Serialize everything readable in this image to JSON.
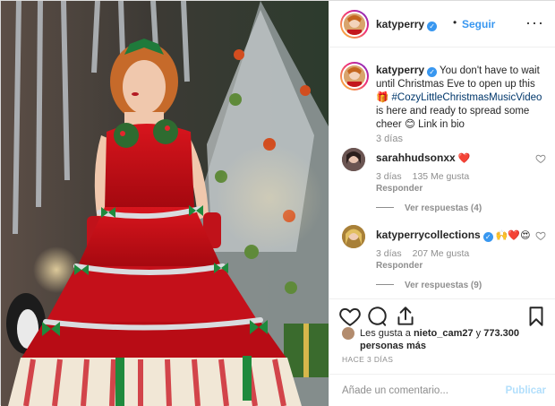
{
  "header": {
    "username": "katyperry",
    "separator": "•",
    "follow_label": "Seguir",
    "more_icon": "more-horizontal-icon"
  },
  "caption": {
    "username": "katyperry",
    "text_before": " You don't have to wait until Christmas Eve to open up this 🎁 ",
    "hashtag": "#CozyLittleChristmasMusicVideo",
    "text_after": " is here and ready to spread some cheer 😊 Link in bio",
    "time": "3 días"
  },
  "comments": [
    {
      "username": "sarahhudsonxx",
      "text": "❤️",
      "time": "3 días",
      "likes": "135 Me gusta",
      "reply_label": "Responder",
      "view_replies": "Ver respuestas (4)"
    },
    {
      "username": "katyperrycollections",
      "text": "🙌❤️😍",
      "time": "3 días",
      "likes": "207 Me gusta",
      "reply_label": "Responder",
      "view_replies": "Ver respuestas (9)"
    }
  ],
  "likes": {
    "prefix": "Les gusta a ",
    "liker": "nieto_cam27",
    "conj": " y ",
    "others": "773.300 personas más"
  },
  "timestamp": "HACE 3 DÍAS",
  "add_comment": {
    "placeholder": "Añade un comentario...",
    "publish_label": "Publicar"
  },
  "colors": {
    "link_blue": "#3897f0",
    "hashtag": "#00376b",
    "muted": "#8e8e8e",
    "publish_disabled": "#b2dffc",
    "heart_red": "#ed4956"
  }
}
